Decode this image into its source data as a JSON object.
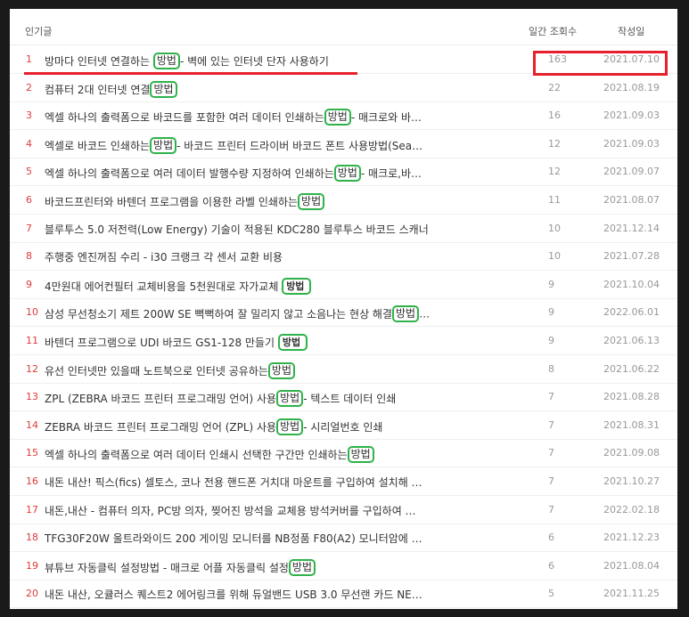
{
  "header": {
    "title": "인기글",
    "views": "일간 조회수",
    "date": "작성일"
  },
  "rows": [
    {
      "rank": "1",
      "before": "방마다 인터넷 연결하는 ",
      "kw": "방법",
      "after": "- 벽에 있는 인터넷 단자 사용하기",
      "views": "163",
      "date": "2021.07.10"
    },
    {
      "rank": "2",
      "before": "컴퓨터 2대 인터넷 연결",
      "kw": "방법",
      "after": "",
      "views": "22",
      "date": "2021.08.19"
    },
    {
      "rank": "3",
      "before": "엑셀 하나의 출력폼으로 바코드를 포함한 여러 데이터 인쇄하는",
      "kw": "방법",
      "after": "- 매크로와 바…",
      "views": "16",
      "date": "2021.09.03"
    },
    {
      "rank": "4",
      "before": "엑셀로 바코드 인쇄하는",
      "kw": "방법",
      "after": "- 바코드 프린터 드라이버 바코드 폰트 사용방법(Sea…",
      "views": "12",
      "date": "2021.09.03"
    },
    {
      "rank": "5",
      "before": "엑셀 하나의 출력폼으로 여러 데이터 발행수량 지정하여 인쇄하는",
      "kw": "방법",
      "after": "- 매크로,바…",
      "views": "12",
      "date": "2021.09.07"
    },
    {
      "rank": "6",
      "before": "바코드프린터와 바텐더 프로그램을 이용한 라벨 인쇄하는",
      "kw": "방법",
      "after": "",
      "views": "11",
      "date": "2021.08.07"
    },
    {
      "rank": "7",
      "before": "블루투스 5.0 저전력(Low Energy) 기술이 적용된 KDC280 블루투스 바코드 스캐너",
      "kw": "",
      "after": "",
      "views": "10",
      "date": "2021.12.14"
    },
    {
      "rank": "8",
      "before": "주행중 엔진꺼짐 수리 - i30 크랭크 각 센서 교환 비용",
      "kw": "",
      "after": "",
      "views": "10",
      "date": "2021.07.28"
    },
    {
      "rank": "9",
      "before": "4만원대 에어컨필터 교체비용을 5천원대로 자가교체 ",
      "kwb": "방법",
      "after": "",
      "views": "9",
      "date": "2021.10.04"
    },
    {
      "rank": "10",
      "before": "삼성 무선청소기 제트 200W SE 뻑뻑하여 잘 밀리지 않고 소음나는 현상 해결",
      "kw": "방법",
      "after": "…",
      "views": "9",
      "date": "2022.06.01"
    },
    {
      "rank": "11",
      "before": "바텐더 프로그램으로 UDI 바코드 GS1-128 만들기 ",
      "kwb": "방법",
      "after": "",
      "views": "9",
      "date": "2021.06.13"
    },
    {
      "rank": "12",
      "before": "유선 인터넷만 있을때 노트북으로 인터넷 공유하는",
      "kw": "방법",
      "after": "",
      "views": "8",
      "date": "2021.06.22"
    },
    {
      "rank": "13",
      "before": "ZPL (ZEBRA 바코드 프린터 프로그래밍 언어) 사용",
      "kw": "방법",
      "after": "- 텍스트 데이터 인쇄",
      "views": "7",
      "date": "2021.08.28"
    },
    {
      "rank": "14",
      "before": "ZEBRA 바코드 프린터 프로그래밍 언어 (ZPL) 사용",
      "kw": "방법",
      "after": "- 시리얼번호 인쇄",
      "views": "7",
      "date": "2021.08.31"
    },
    {
      "rank": "15",
      "before": "엑셀 하나의 출력폼으로 여러 데이터 인쇄시 선택한 구간만 인쇄하는",
      "kw": "방법",
      "after": "",
      "views": "7",
      "date": "2021.09.08"
    },
    {
      "rank": "16",
      "before": "내돈 내산! 픽스(fics) 셀토스, 코나 전용 핸드폰 거치대 마운트를 구입하여 설치해 …",
      "kw": "",
      "after": "",
      "views": "7",
      "date": "2021.10.27"
    },
    {
      "rank": "17",
      "before": "내돈,내산 - 컴퓨터 의자, PC방 의자, 찢어진 방석을 교체용 방석커버를 구입하여 …",
      "kw": "",
      "after": "",
      "views": "7",
      "date": "2022.02.18"
    },
    {
      "rank": "18",
      "before": "TFG30F20W 울트라와이드 200 게이밍 모니터를 NB정품 F80(A2) 모니터암에 …",
      "kw": "",
      "after": "",
      "views": "6",
      "date": "2021.12.23"
    },
    {
      "rank": "19",
      "before": "뷰튜브 자동클릭 설정방법 - 매크로 어플 자동클릭 설정",
      "kw": "방법",
      "after": "",
      "views": "6",
      "date": "2021.08.04"
    },
    {
      "rank": "20",
      "before": "내돈 내산, 오큘러스 퀘스트2 에어링크를 위해 듀얼밴드 USB 3.0 무선랜 카드 NE…",
      "kw": "",
      "after": "",
      "views": "5",
      "date": "2021.11.25"
    }
  ],
  "colors": {
    "rank": "#e03a3a",
    "highlight_red": "#e8202b",
    "keyword_box": "#2fb24a"
  }
}
